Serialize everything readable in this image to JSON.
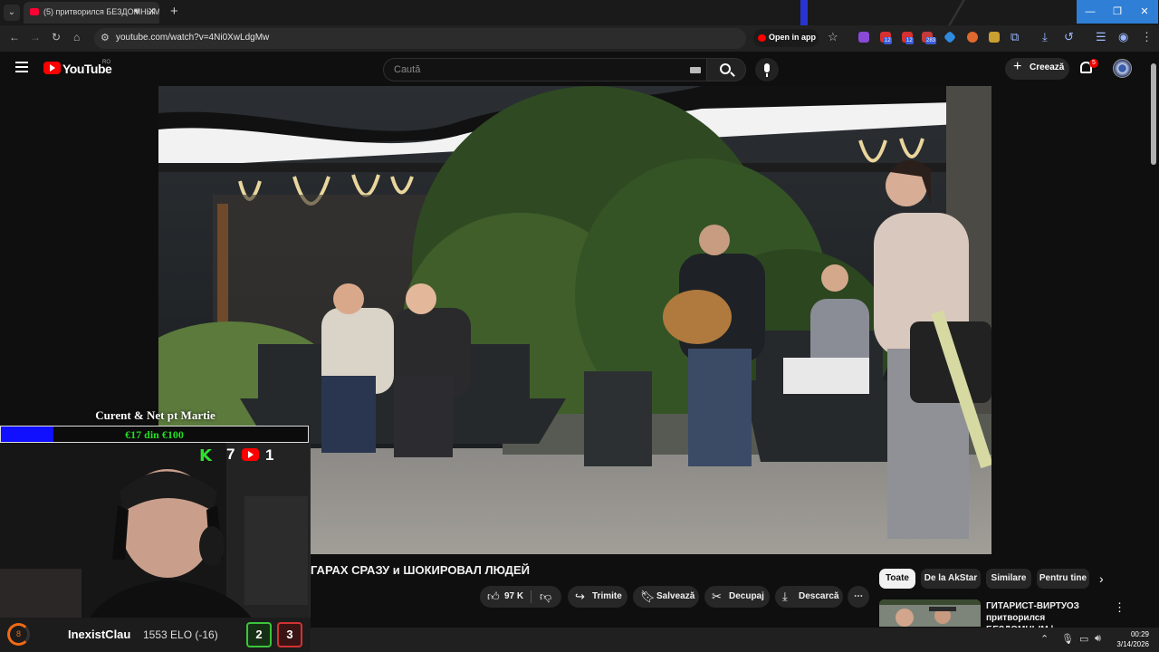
{
  "browser": {
    "tab_title": "(5) притворился БЕЗДОМНЫМ",
    "new_tab": "+",
    "url": "youtube.com/watch?v=4Ni0XwLdgMw",
    "open_in_app": "Open in app",
    "window_controls": [
      "—",
      "❐",
      "✕"
    ],
    "extension_badges": [
      "12",
      "12",
      "283"
    ]
  },
  "youtube": {
    "brand": "YouTube",
    "country_code": "RO",
    "search_placeholder": "Caută",
    "create_label": "Creează",
    "notification_count": "5"
  },
  "video": {
    "title": "ГАРАХ СРАЗУ и ШОКИРОВАЛ ЛЮДЕЙ",
    "likes": "97 K",
    "share_label": "Trimite",
    "save_label": "Salvează",
    "clip_label": "Decupaj",
    "download_label": "Descarcă",
    "more_label": "⋯"
  },
  "chips": [
    {
      "label": "Toate",
      "active": true
    },
    {
      "label": "De la AkStar",
      "active": false
    },
    {
      "label": "Similare",
      "active": false
    },
    {
      "label": "Pentru tine",
      "active": false
    }
  ],
  "recommendation": {
    "title": "ГИТАРИСТ-ВИРТУОЗ притворился БЕЗДОМНЫМ | ..."
  },
  "overlay": {
    "goal_title": "Curent & Net pt Martie",
    "goal_text": "€17 din €100",
    "goal_progress": 0.17,
    "kick_symbol": "K",
    "kick_count": "7",
    "youtube_count": "1",
    "chess": {
      "level": "8",
      "username": "InexistClau",
      "elo": "1553 ELO (-16)",
      "wins": "2",
      "losses": "3"
    }
  },
  "taskbar": {
    "time": "00:29",
    "date": "3/14/2026"
  },
  "colors": {
    "accent_red": "#ff0000",
    "goal_fill": "#1010ff",
    "goal_text": "#22dd22",
    "kick_green": "#2fe02f"
  }
}
